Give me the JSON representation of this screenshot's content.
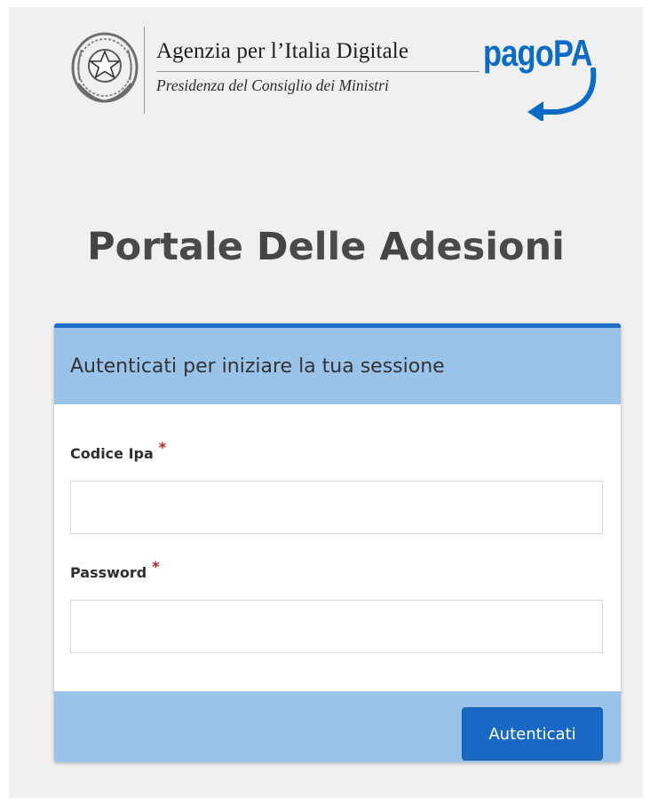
{
  "header": {
    "emblem_icon": "italian-republic-emblem-icon",
    "agency_name": "Agenzia per l’Italia Digitale",
    "agency_subtitle": "Presidenza del Consiglio dei Ministri",
    "pagopa_logo_text": "pagoPA",
    "pagopa_color": "#0a6bc9"
  },
  "portal": {
    "title_parts": [
      {
        "bold": "P",
        "rest": "ortale"
      },
      {
        "bold": "D",
        "rest": "elle"
      },
      {
        "bold": "A",
        "rest": "desioni"
      }
    ]
  },
  "login": {
    "heading": "Autenticati per iniziare la tua sessione",
    "fields": [
      {
        "label": "Codice Ipa",
        "required_mark": "*",
        "value": "",
        "placeholder": ""
      },
      {
        "label": "Password",
        "required_mark": "*",
        "value": "",
        "placeholder": ""
      }
    ],
    "submit_label": "Autenticati",
    "accent_color": "#1f6fc9",
    "panel_color": "#9ac3ea"
  }
}
